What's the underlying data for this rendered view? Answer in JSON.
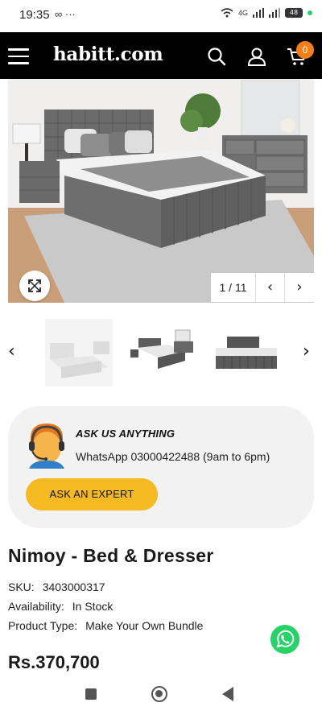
{
  "status_bar": {
    "time": "19:35",
    "left_icons": "∞ ···",
    "network": "4G",
    "battery": "48"
  },
  "header": {
    "logo": "habitt.com",
    "cart_count": "0",
    "icons": [
      "menu-icon",
      "search-icon",
      "user-icon",
      "cart-icon"
    ]
  },
  "gallery": {
    "counter": "1 / 11",
    "prev": "‹",
    "next": "›",
    "thumb_prev": "‹",
    "thumb_next": "›"
  },
  "expert": {
    "title": "ASK US ANYTHING",
    "phone": "WhatsApp 03000422488 (9am to 6pm)",
    "button": "ASK AN EXPERT"
  },
  "product": {
    "title": "Nimoy - Bed & Dresser",
    "sku_label": "SKU:",
    "sku_value": "3403000317",
    "availability_label": "Availability:",
    "availability_value": "In Stock",
    "type_label": "Product Type:",
    "type_value": "Make Your Own Bundle",
    "price": "Rs.370,700"
  },
  "colors": {
    "header_bg": "#000000",
    "accent_orange": "#f57f17",
    "cta_yellow": "#f5b921",
    "whatsapp_green": "#25d366"
  }
}
